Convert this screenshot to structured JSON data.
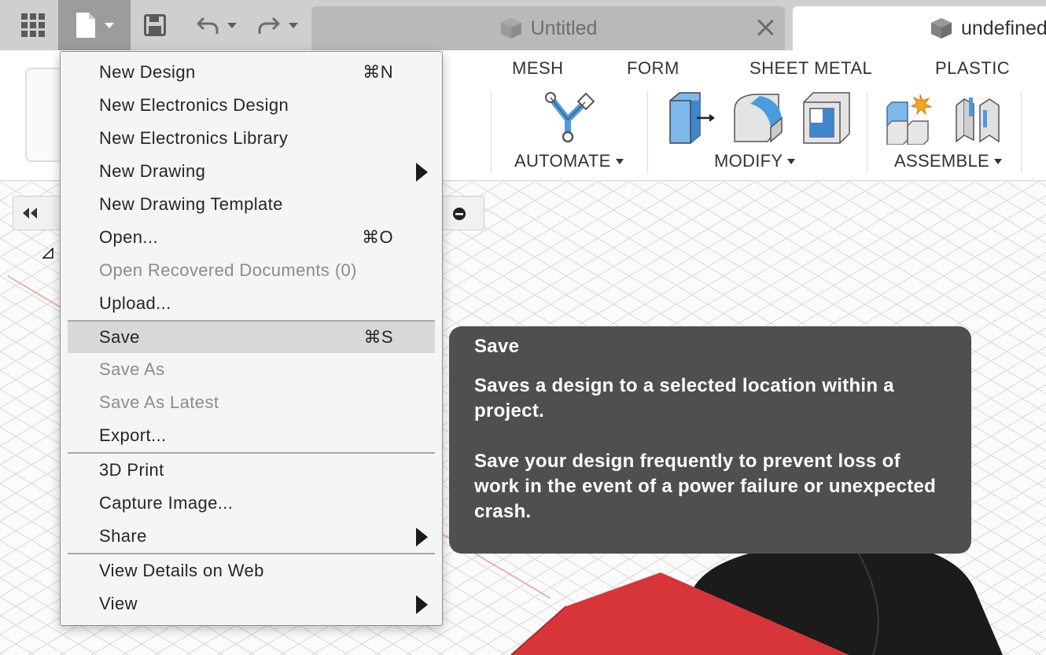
{
  "titlebar": {
    "tabs": [
      {
        "label": "Untitled",
        "icon": "cube-icon",
        "active": false
      },
      {
        "label": "undefined",
        "icon": "cube-icon",
        "active": true
      }
    ]
  },
  "toolbar": {
    "tabs": [
      "MESH",
      "FORM",
      "SHEET METAL",
      "PLASTIC"
    ],
    "groups": [
      "AUTOMATE",
      "MODIFY",
      "ASSEMBLE"
    ]
  },
  "file_menu": {
    "items": [
      {
        "label": "New Design",
        "shortcut": "⌘N"
      },
      {
        "label": "New Electronics Design"
      },
      {
        "label": "New Electronics Library"
      },
      {
        "label": "New Drawing",
        "submenu": true
      },
      {
        "label": "New Drawing Template"
      },
      {
        "label": "Open...",
        "shortcut": "⌘O"
      },
      {
        "label": "Open Recovered Documents (0)",
        "disabled": true
      },
      {
        "label": "Upload..."
      },
      {
        "label": "Save",
        "shortcut": "⌘S",
        "highlighted": true
      },
      {
        "label": "Save As",
        "disabled": true
      },
      {
        "label": "Save As Latest",
        "disabled": true
      },
      {
        "label": "Export..."
      },
      {
        "label": "3D Print"
      },
      {
        "label": "Capture Image..."
      },
      {
        "label": "Share",
        "submenu": true
      },
      {
        "label": "View Details on Web"
      },
      {
        "label": "View",
        "submenu": true
      }
    ]
  },
  "tooltip": {
    "title": "Save",
    "description": "Saves a design to a selected location within a project.",
    "detail": "Save your design frequently to prevent loss of work in the event of a power failure or unexpected crash."
  },
  "colors": {
    "accent_blue": "#4a9be0",
    "model_red": "#d8353b",
    "model_black": "#1b1b1b",
    "tooltip_bg": "#4f4f4f"
  }
}
